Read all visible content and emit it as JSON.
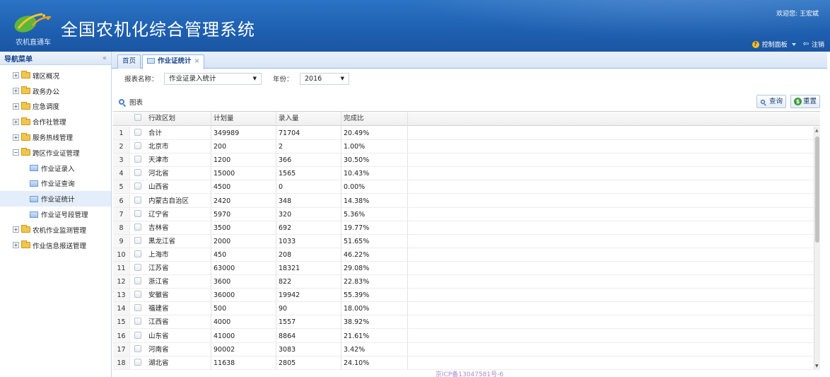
{
  "header": {
    "title": "全国农机化综合管理系统",
    "subtitle": "农机直通车",
    "welcome": "欢迎您: 王宏斌",
    "control_panel": "控制面板",
    "logout": "注销",
    "logo_icon": "wheat-leaf-logo"
  },
  "sidebar": {
    "header": "导航菜单",
    "collapse_icon": "«",
    "items": [
      {
        "label": "辖区概况",
        "type": "folder",
        "expander": "+"
      },
      {
        "label": "政务办公",
        "type": "folder",
        "expander": "+"
      },
      {
        "label": "应急调度",
        "type": "folder",
        "expander": "+"
      },
      {
        "label": "合作社管理",
        "type": "folder",
        "expander": "+"
      },
      {
        "label": "服务热线管理",
        "type": "folder",
        "expander": "+"
      },
      {
        "label": "跨区作业证管理",
        "type": "folder",
        "expander": "−"
      },
      {
        "label": "作业证录入",
        "type": "doc"
      },
      {
        "label": "作业证查询",
        "type": "doc"
      },
      {
        "label": "作业证统计",
        "type": "doc",
        "active": true
      },
      {
        "label": "作业证号段管理",
        "type": "doc"
      },
      {
        "label": "农机作业监测管理",
        "type": "folder",
        "expander": "+"
      },
      {
        "label": "作业信息报送管理",
        "type": "folder",
        "expander": "+"
      }
    ]
  },
  "tabs": {
    "home": "首页",
    "active": "作业证统计",
    "close": "×"
  },
  "filters": {
    "report_label": "报表名称：",
    "report_value": "作业证录入统计",
    "year_label": "年份：",
    "year_value": "2016"
  },
  "toolbar": {
    "chart": "图表",
    "query": "查询",
    "reset": "重置"
  },
  "grid": {
    "columns": [
      "行政区划",
      "计划量",
      "录入量",
      "完成比"
    ],
    "rows": [
      {
        "n": "1",
        "area": "合计",
        "plan": "349989",
        "entry": "71704",
        "ratio": "20.49%"
      },
      {
        "n": "2",
        "area": "北京市",
        "plan": "200",
        "entry": "2",
        "ratio": "1.00%"
      },
      {
        "n": "3",
        "area": "天津市",
        "plan": "1200",
        "entry": "366",
        "ratio": "30.50%"
      },
      {
        "n": "4",
        "area": "河北省",
        "plan": "15000",
        "entry": "1565",
        "ratio": "10.43%"
      },
      {
        "n": "5",
        "area": "山西省",
        "plan": "4500",
        "entry": "0",
        "ratio": "0.00%"
      },
      {
        "n": "6",
        "area": "内蒙古自治区",
        "plan": "2420",
        "entry": "348",
        "ratio": "14.38%"
      },
      {
        "n": "7",
        "area": "辽宁省",
        "plan": "5970",
        "entry": "320",
        "ratio": "5.36%"
      },
      {
        "n": "8",
        "area": "吉林省",
        "plan": "3500",
        "entry": "692",
        "ratio": "19.77%"
      },
      {
        "n": "9",
        "area": "黑龙江省",
        "plan": "2000",
        "entry": "1033",
        "ratio": "51.65%"
      },
      {
        "n": "10",
        "area": "上海市",
        "plan": "450",
        "entry": "208",
        "ratio": "46.22%"
      },
      {
        "n": "11",
        "area": "江苏省",
        "plan": "63000",
        "entry": "18321",
        "ratio": "29.08%"
      },
      {
        "n": "12",
        "area": "浙江省",
        "plan": "3600",
        "entry": "822",
        "ratio": "22.83%"
      },
      {
        "n": "13",
        "area": "安徽省",
        "plan": "36000",
        "entry": "19942",
        "ratio": "55.39%"
      },
      {
        "n": "14",
        "area": "福建省",
        "plan": "500",
        "entry": "90",
        "ratio": "18.00%"
      },
      {
        "n": "15",
        "area": "江西省",
        "plan": "4000",
        "entry": "1557",
        "ratio": "38.92%"
      },
      {
        "n": "16",
        "area": "山东省",
        "plan": "41000",
        "entry": "8864",
        "ratio": "21.61%"
      },
      {
        "n": "17",
        "area": "河南省",
        "plan": "90002",
        "entry": "3083",
        "ratio": "3.42%"
      },
      {
        "n": "18",
        "area": "湖北省",
        "plan": "11638",
        "entry": "2805",
        "ratio": "24.10%"
      }
    ]
  },
  "footer": "京ICP备13047581号-6",
  "colors": {
    "header_blue": "#1e5fb0",
    "link_blue": "#15428b",
    "footer_purple": "#a98bd0"
  }
}
